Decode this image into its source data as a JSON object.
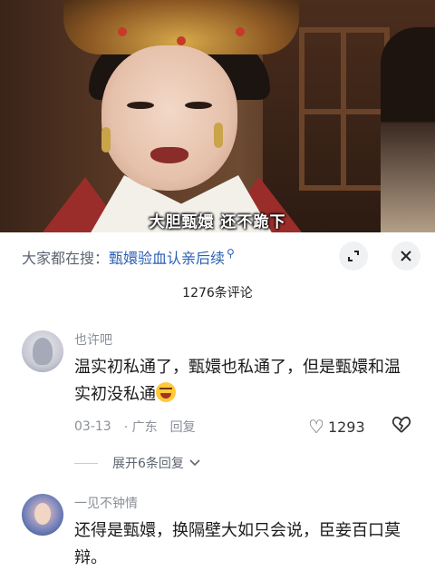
{
  "video": {
    "subtitle": "大胆甄嬛 还不跪下"
  },
  "search": {
    "prefix": "大家都在搜：",
    "query": "甄嬛验血认亲后续"
  },
  "comments_count": "1276条评论",
  "comments": [
    {
      "username": "也许吧",
      "text": "温实初私通了，甄嬛也私通了，但是甄嬛和温实初没私通",
      "date": "03-13",
      "location": "广东",
      "reply_label": "回复",
      "likes": "1293",
      "expand_label": "展开6条回复"
    },
    {
      "username": "一见不钟情",
      "text": "还得是甄嬛，换隔壁大如只会说，臣妾百口莫辩。"
    }
  ],
  "icons": {
    "search": "search-icon",
    "minimize": "minimize-icon",
    "close": "close-icon",
    "like": "heart-icon",
    "dislike": "broken-heart-icon",
    "expand": "chevron-down-icon",
    "emoji": "laughing-crying-emoji"
  }
}
